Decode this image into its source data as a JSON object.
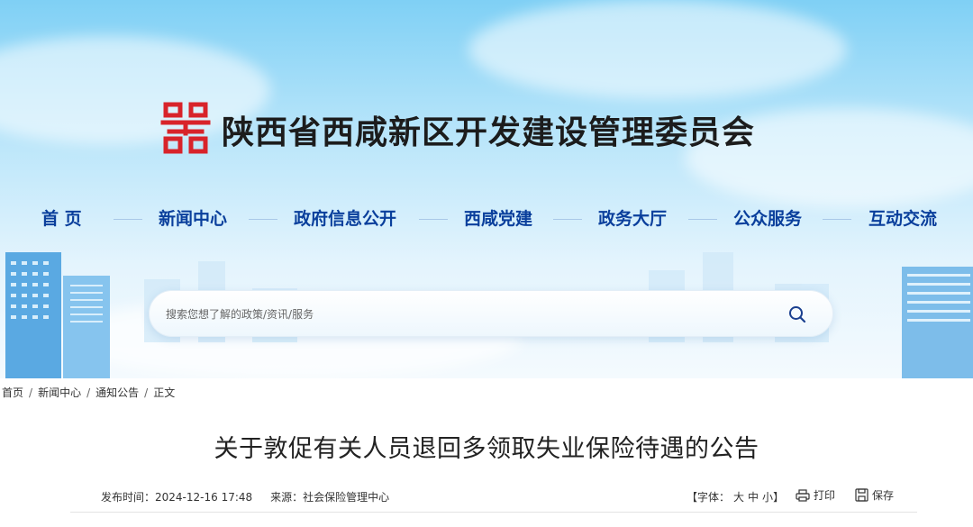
{
  "header": {
    "title": "陕西省西咸新区开发建设管理委员会",
    "logo_glyph": "陕西省西咸新区 emblem",
    "brand_color": "#d8232a"
  },
  "nav": {
    "items": [
      {
        "label": "首  页"
      },
      {
        "label": "新闻中心"
      },
      {
        "label": "政府信息公开"
      },
      {
        "label": "西咸党建"
      },
      {
        "label": "政务大厅"
      },
      {
        "label": "公众服务"
      },
      {
        "label": "互动交流"
      }
    ],
    "text_color": "#0a3f9c"
  },
  "search": {
    "placeholder": "搜索您想了解的政策/资讯/服务",
    "icon": "search-icon"
  },
  "breadcrumb": {
    "items": [
      "首页",
      "新闻中心",
      "通知公告",
      "正文"
    ],
    "separator": "/"
  },
  "article": {
    "title": "关于敦促有关人员退回多领取失业保险待遇的公告",
    "published_label": "发布时间：",
    "published_value": "2024-12-16 17:48",
    "source_label": "来源：",
    "source_value": "社会保险管理中心"
  },
  "tools": {
    "font_label": "【字体：",
    "font_large": "大",
    "font_medium": "中",
    "font_small": "小",
    "font_close": "】",
    "print_label": "打印",
    "print_icon": "printer-icon",
    "save_label": "保存",
    "save_icon": "save-icon"
  }
}
